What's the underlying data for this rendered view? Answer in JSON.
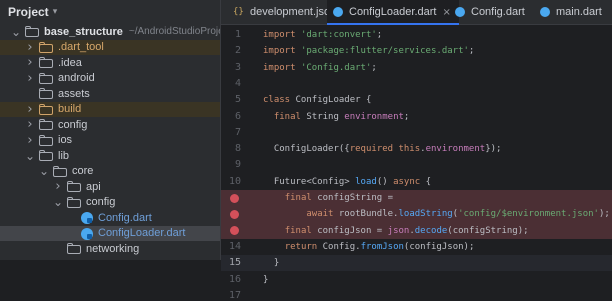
{
  "project": {
    "title": "Project",
    "tree": [
      {
        "name": "base_structure",
        "path": "~/AndroidStudioProjects/base",
        "type": "root",
        "arrow": "v",
        "level": 0
      },
      {
        "name": ".dart_tool",
        "type": "folder",
        "arrow": ">",
        "level": 1,
        "excluded": true
      },
      {
        "name": ".idea",
        "type": "folder",
        "arrow": ">",
        "level": 1
      },
      {
        "name": "android",
        "type": "folder",
        "arrow": ">",
        "level": 1
      },
      {
        "name": "assets",
        "type": "folder",
        "arrow": "",
        "level": 1
      },
      {
        "name": "build",
        "type": "folder",
        "arrow": ">",
        "level": 1,
        "excluded": true
      },
      {
        "name": "config",
        "type": "folder",
        "arrow": ">",
        "level": 1
      },
      {
        "name": "ios",
        "type": "folder",
        "arrow": ">",
        "level": 1
      },
      {
        "name": "lib",
        "type": "folder",
        "arrow": "v",
        "level": 1
      },
      {
        "name": "core",
        "type": "folder",
        "arrow": "v",
        "level": 2
      },
      {
        "name": "api",
        "type": "folder",
        "arrow": ">",
        "level": 3
      },
      {
        "name": "config",
        "type": "folder",
        "arrow": "v",
        "level": 3
      },
      {
        "name": "Config.dart",
        "type": "dart",
        "arrow": "",
        "level": 4
      },
      {
        "name": "ConfigLoader.dart",
        "type": "dart",
        "arrow": "",
        "level": 4,
        "selected": true
      },
      {
        "name": "networking",
        "type": "folder",
        "arrow": "",
        "level": 3
      }
    ]
  },
  "tabs": [
    {
      "label": "development.json",
      "icon": "json-icon",
      "active": false
    },
    {
      "label": "ConfigLoader.dart",
      "icon": "dart-icon",
      "active": true,
      "close": "×"
    },
    {
      "label": "Config.dart",
      "icon": "dart-icon",
      "active": false
    },
    {
      "label": "main.dart",
      "icon": "dart-icon",
      "active": false
    }
  ],
  "editor": {
    "current_line": 15,
    "breakpoint_lines": [
      11,
      12,
      13
    ],
    "highlight_lines": [
      11,
      12,
      13
    ],
    "lines": [
      {
        "n": 1,
        "tokens": [
          [
            "kw",
            "import "
          ],
          [
            "str",
            "'dart:convert'"
          ],
          [
            "",
            "; "
          ]
        ]
      },
      {
        "n": 2,
        "tokens": [
          [
            "kw",
            "import "
          ],
          [
            "str",
            "'package:flutter/services.dart'"
          ],
          [
            "",
            ";"
          ]
        ]
      },
      {
        "n": 3,
        "tokens": [
          [
            "kw",
            "import "
          ],
          [
            "str",
            "'Config.dart'"
          ],
          [
            "",
            ";"
          ]
        ]
      },
      {
        "n": 4,
        "tokens": []
      },
      {
        "n": 5,
        "tokens": [
          [
            "kw",
            "class "
          ],
          [
            "",
            "ConfigLoader {"
          ]
        ]
      },
      {
        "n": 6,
        "tokens": [
          [
            "",
            "  "
          ],
          [
            "kw",
            "final "
          ],
          [
            "",
            "String "
          ],
          [
            "fld",
            "environment"
          ],
          [
            "",
            ";"
          ]
        ]
      },
      {
        "n": 7,
        "tokens": []
      },
      {
        "n": 8,
        "tokens": [
          [
            "",
            "  ConfigLoader({"
          ],
          [
            "kw",
            "required this"
          ],
          [
            "",
            "."
          ],
          [
            "fld",
            "environment"
          ],
          [
            "",
            "});"
          ]
        ]
      },
      {
        "n": 9,
        "tokens": []
      },
      {
        "n": 10,
        "tokens": [
          [
            "",
            "  Future<Config> "
          ],
          [
            "fn",
            "load"
          ],
          [
            "",
            "() "
          ],
          [
            "kw",
            "async"
          ],
          [
            "",
            " {"
          ]
        ]
      },
      {
        "n": 11,
        "tokens": [
          [
            "",
            "    "
          ],
          [
            "kw",
            "final "
          ],
          [
            "",
            "configString ="
          ]
        ]
      },
      {
        "n": 12,
        "tokens": [
          [
            "",
            "        "
          ],
          [
            "kw",
            "await "
          ],
          [
            "",
            "rootBundle."
          ],
          [
            "fn",
            "loadString"
          ],
          [
            "",
            "("
          ],
          [
            "str",
            "'config/$environment.json'"
          ],
          [
            "",
            ");"
          ]
        ]
      },
      {
        "n": 13,
        "tokens": [
          [
            "",
            "    "
          ],
          [
            "kw",
            "final "
          ],
          [
            "",
            "configJson = "
          ],
          [
            "fld",
            "json"
          ],
          [
            "",
            "."
          ],
          [
            "fn",
            "decode"
          ],
          [
            "",
            "(configString);"
          ]
        ]
      },
      {
        "n": 14,
        "tokens": [
          [
            "",
            "    "
          ],
          [
            "kw",
            "return "
          ],
          [
            "",
            "Config."
          ],
          [
            "fn",
            "fromJson"
          ],
          [
            "",
            "(configJson);"
          ]
        ]
      },
      {
        "n": 15,
        "tokens": [
          [
            "",
            "  }"
          ]
        ]
      },
      {
        "n": 16,
        "tokens": [
          [
            "",
            "}"
          ]
        ]
      },
      {
        "n": 17,
        "tokens": []
      }
    ]
  }
}
